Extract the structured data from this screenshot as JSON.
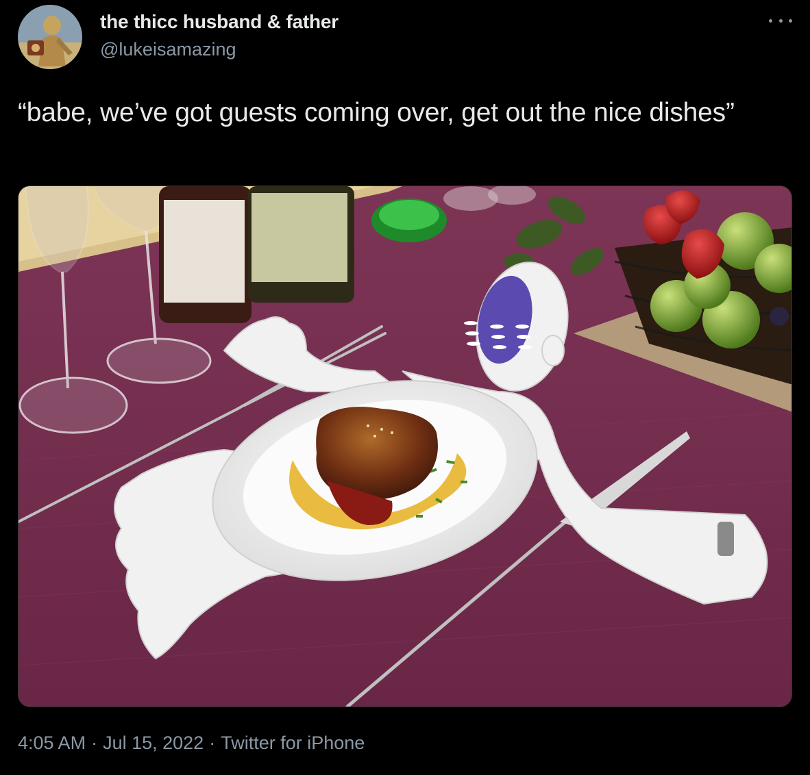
{
  "tweet": {
    "author": {
      "display_name": "the thicc husband & father",
      "handle": "@lukeisamazing",
      "avatar_icon": "avatar-image"
    },
    "text": "“babe, we’ve got guests coming over, get out the nice dishes”",
    "media_icon": "photo-image",
    "more_icon": "more-options-icon",
    "meta": {
      "time": "4:05 AM",
      "separator": "·",
      "date": "Jul 15, 2022",
      "client": "Twitter for iPhone"
    }
  },
  "colors": {
    "background": "#000000",
    "primary_text": "#e7e9ea",
    "secondary_text": "#8b98a5",
    "border": "#2f3336"
  }
}
